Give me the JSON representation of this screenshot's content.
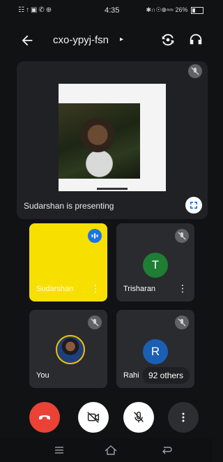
{
  "status": {
    "left_icons": "☷↑▣✆⊕",
    "time": "4:35",
    "right": "✱∩☉⊕≈≈ 26%"
  },
  "appbar": {
    "title": "cxo-ypyj-fsn",
    "caret": "▸"
  },
  "presentation": {
    "label": "Sudarshan is presenting"
  },
  "tiles": [
    {
      "name": "Sudarshan",
      "state": "speaking"
    },
    {
      "name": "Trisharan",
      "initial": "T",
      "avatar_color": "#1e7e34",
      "state": "muted"
    },
    {
      "name": "You",
      "state": "muted"
    },
    {
      "name": "Rahi",
      "initial": "R",
      "avatar_color": "#1a5fb4",
      "state": "muted"
    }
  ],
  "others": {
    "label": "92 others"
  },
  "controls": {
    "more_label": "⋮"
  },
  "colors": {
    "background": "#111214",
    "speaking_tile": "#f7e000",
    "end_call": "#ea4335",
    "accent_blue": "#1a73e8"
  }
}
